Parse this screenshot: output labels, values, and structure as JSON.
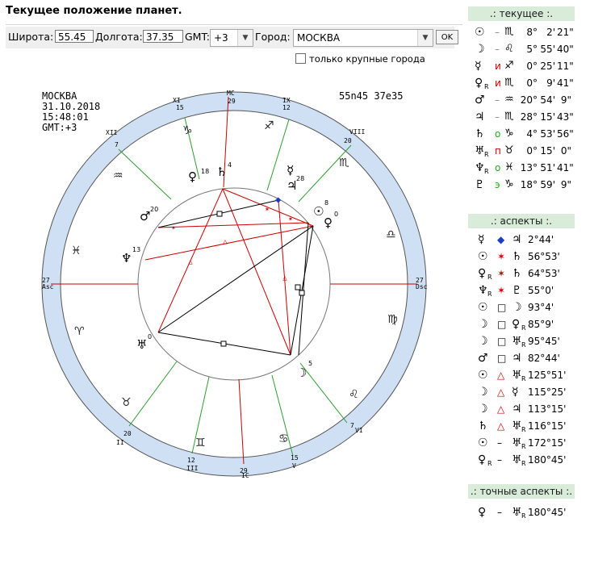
{
  "page": {
    "title": "Текущее положение планет."
  },
  "controls": {
    "lat_label": "Широта:",
    "lat_value": "55.45",
    "lon_label": "Долгота:",
    "lon_value": "37.35",
    "gmt_label": "GMT:",
    "gmt_value": "+3",
    "city_label": "Город:",
    "city_value": "МОСКВА",
    "ok_label": "OK",
    "only_big_label": "только крупные города"
  },
  "chart_info": {
    "city": "МОСКВА",
    "date": "31.10.2018",
    "time": "15:48:01",
    "gmt": "GMT:+3",
    "coords": "55n45  37e35"
  },
  "houses": {
    "mc": "MC",
    "mc_deg": "29",
    "ic": "IC",
    "ic_deg": "29",
    "asc": "Asc",
    "asc_deg": "27",
    "dsc": "Dsc",
    "dsc_deg": "27",
    "xi": "XI",
    "xi_deg": "15",
    "ix": "IX",
    "ix_deg": "12",
    "xii": "XII",
    "xii_deg": "7",
    "viii": "VIII",
    "viii_deg": "20",
    "ii": "II",
    "ii_deg": "20",
    "iii": "III",
    "iii_deg": "12",
    "v": "V",
    "v_deg": "15",
    "vi": "VI",
    "vi_deg": "7"
  },
  "chart_planet_degrees": {
    "mars": "20",
    "venus": "18",
    "saturn": "4",
    "jupiter": "28",
    "sun": "8",
    "pluto": "0",
    "neptune": "13",
    "uranus": "0",
    "moon": "5"
  },
  "current": {
    "header": ".: текущее :.",
    "rows": [
      {
        "icon": "sun-icon",
        "glyph": "☉",
        "r": "",
        "mark": "–",
        "mark_color": "#888888",
        "sign": "♏",
        "deg": "8°",
        "min": "2'",
        "sec": "21\""
      },
      {
        "icon": "moon-icon",
        "glyph": "☽",
        "r": "",
        "mark": "–",
        "mark_color": "#888888",
        "sign": "♌",
        "deg": "5°",
        "min": "55'",
        "sec": "40\""
      },
      {
        "icon": "mercury-icon",
        "glyph": "☿",
        "r": "",
        "mark": "и",
        "mark_color": "#cc0000",
        "sign": "♐",
        "deg": "0°",
        "min": "25'",
        "sec": "11\""
      },
      {
        "icon": "venus-icon",
        "glyph": "♀",
        "r": "R",
        "mark": "и",
        "mark_color": "#cc0000",
        "sign": "♏",
        "deg": "0°",
        "min": "9'",
        "sec": "41\""
      },
      {
        "icon": "mars-icon",
        "glyph": "♂",
        "r": "",
        "mark": "–",
        "mark_color": "#888888",
        "sign": "♒",
        "deg": "20°",
        "min": "54'",
        "sec": "9\""
      },
      {
        "icon": "jupiter-icon",
        "glyph": "♃",
        "r": "",
        "mark": "–",
        "mark_color": "#888888",
        "sign": "♏",
        "deg": "28°",
        "min": "15'",
        "sec": "43\""
      },
      {
        "icon": "saturn-icon",
        "glyph": "♄",
        "r": "",
        "mark": "о",
        "mark_color": "#22aa22",
        "sign": "♑",
        "deg": "4°",
        "min": "53'",
        "sec": "56\""
      },
      {
        "icon": "uranus-icon",
        "glyph": "♅",
        "r": "R",
        "mark": "п",
        "mark_color": "#cc0000",
        "sign": "♉",
        "deg": "0°",
        "min": "15'",
        "sec": "0\""
      },
      {
        "icon": "neptune-icon",
        "glyph": "♆",
        "r": "R",
        "mark": "о",
        "mark_color": "#22aa22",
        "sign": "♓",
        "deg": "13°",
        "min": "51'",
        "sec": "41\""
      },
      {
        "icon": "pluto-icon",
        "glyph": "♇",
        "r": "",
        "mark": "э",
        "mark_color": "#22aa22",
        "sign": "♑",
        "deg": "18°",
        "min": "59'",
        "sec": "9\""
      }
    ]
  },
  "aspects": {
    "header": ".: аспекты :.",
    "rows": [
      {
        "p1": "☿",
        "r1": "",
        "asp": "◆",
        "asp_color": "#1a3cc8",
        "p2": "♃",
        "r2": "",
        "angle": "2°44'"
      },
      {
        "p1": "☉",
        "r1": "",
        "asp": "✶",
        "asp_color": "#cc0000",
        "p2": "♄",
        "r2": "",
        "angle": "56°53'"
      },
      {
        "p1": "♀",
        "r1": "R",
        "asp": "✶",
        "asp_color": "#cc0000",
        "p2": "♄",
        "r2": "",
        "angle": "64°53'"
      },
      {
        "p1": "♆",
        "r1": "R",
        "asp": "✶",
        "asp_color": "#cc0000",
        "p2": "♇",
        "r2": "",
        "angle": "55°0'"
      },
      {
        "p1": "☉",
        "r1": "",
        "asp": "□",
        "asp_color": "#000000",
        "p2": "☽",
        "r2": "",
        "angle": "93°4'"
      },
      {
        "p1": "☽",
        "r1": "",
        "asp": "□",
        "asp_color": "#000000",
        "p2": "♀",
        "r2": "R",
        "angle": "85°9'"
      },
      {
        "p1": "☽",
        "r1": "",
        "asp": "□",
        "asp_color": "#000000",
        "p2": "♅",
        "r2": "R",
        "angle": "95°45'"
      },
      {
        "p1": "♂",
        "r1": "",
        "asp": "□",
        "asp_color": "#000000",
        "p2": "♃",
        "r2": "",
        "angle": "82°44'"
      },
      {
        "p1": "☉",
        "r1": "",
        "asp": "△",
        "asp_color": "#cc0000",
        "p2": "♅",
        "r2": "R",
        "angle": "125°51'"
      },
      {
        "p1": "☽",
        "r1": "",
        "asp": "△",
        "asp_color": "#cc0000",
        "p2": "☿",
        "r2": "",
        "angle": "115°25'"
      },
      {
        "p1": "☽",
        "r1": "",
        "asp": "△",
        "asp_color": "#cc0000",
        "p2": "♃",
        "r2": "",
        "angle": "113°15'"
      },
      {
        "p1": "♄",
        "r1": "",
        "asp": "△",
        "asp_color": "#cc0000",
        "p2": "♅",
        "r2": "R",
        "angle": "116°15'"
      },
      {
        "p1": "☉",
        "r1": "",
        "asp": "–",
        "asp_color": "#000000",
        "p2": "♅",
        "r2": "R",
        "angle": "172°15'"
      },
      {
        "p1": "♀",
        "r1": "R",
        "asp": "–",
        "asp_color": "#000000",
        "p2": "♅",
        "r2": "R",
        "angle": "180°45'"
      }
    ]
  },
  "exact_aspects": {
    "header": ".: точные аспекты :.",
    "rows": [
      {
        "p1": "♀",
        "r1": "",
        "asp": "–",
        "asp_color": "#000000",
        "p2": "♅",
        "r2": "R",
        "angle": "180°45'"
      }
    ]
  },
  "colors": {
    "panel_header": "#d9ecd9",
    "zodiac_ring": "#cfe0f5",
    "red": "#cc0000",
    "green": "#2e9e2e"
  }
}
